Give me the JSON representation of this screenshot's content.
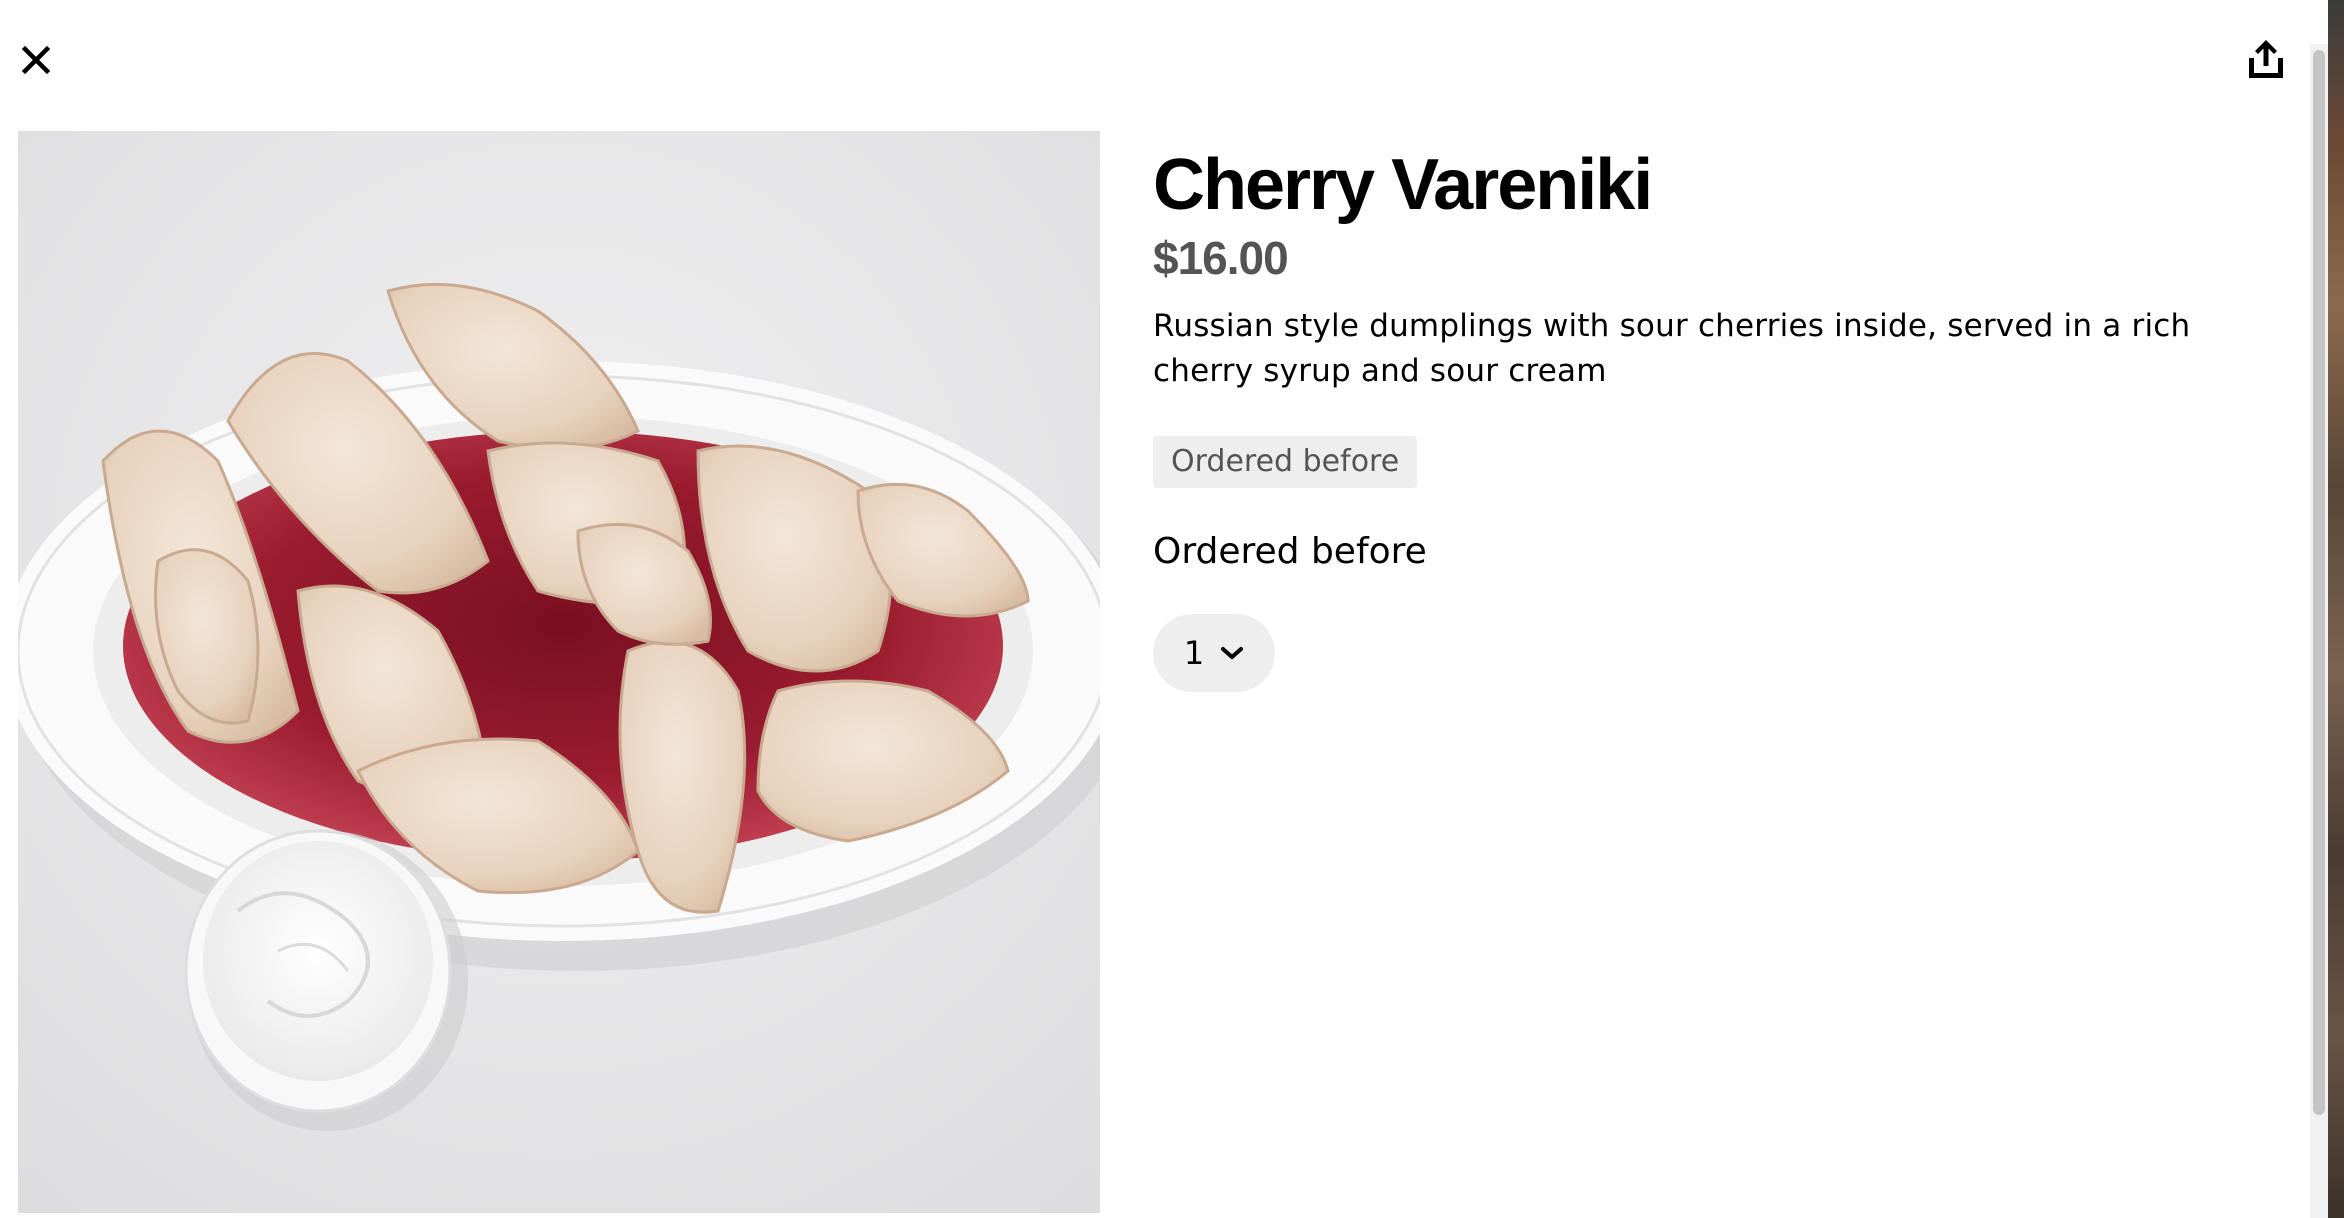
{
  "item": {
    "title": "Cherry Vareniki",
    "price": "$16.00",
    "description": "Russian style dumplings with sour cherries inside, served in a rich cherry syrup and sour cream",
    "badge": "Ordered before",
    "subheading": "Ordered before",
    "quantity": "1"
  },
  "icons": {
    "close": "close-icon",
    "share": "share-icon",
    "dropdown": "chevron-down-icon"
  },
  "colors": {
    "badge_bg": "#eeeeee",
    "price_text": "#545454",
    "select_bg": "#eeeeee"
  }
}
